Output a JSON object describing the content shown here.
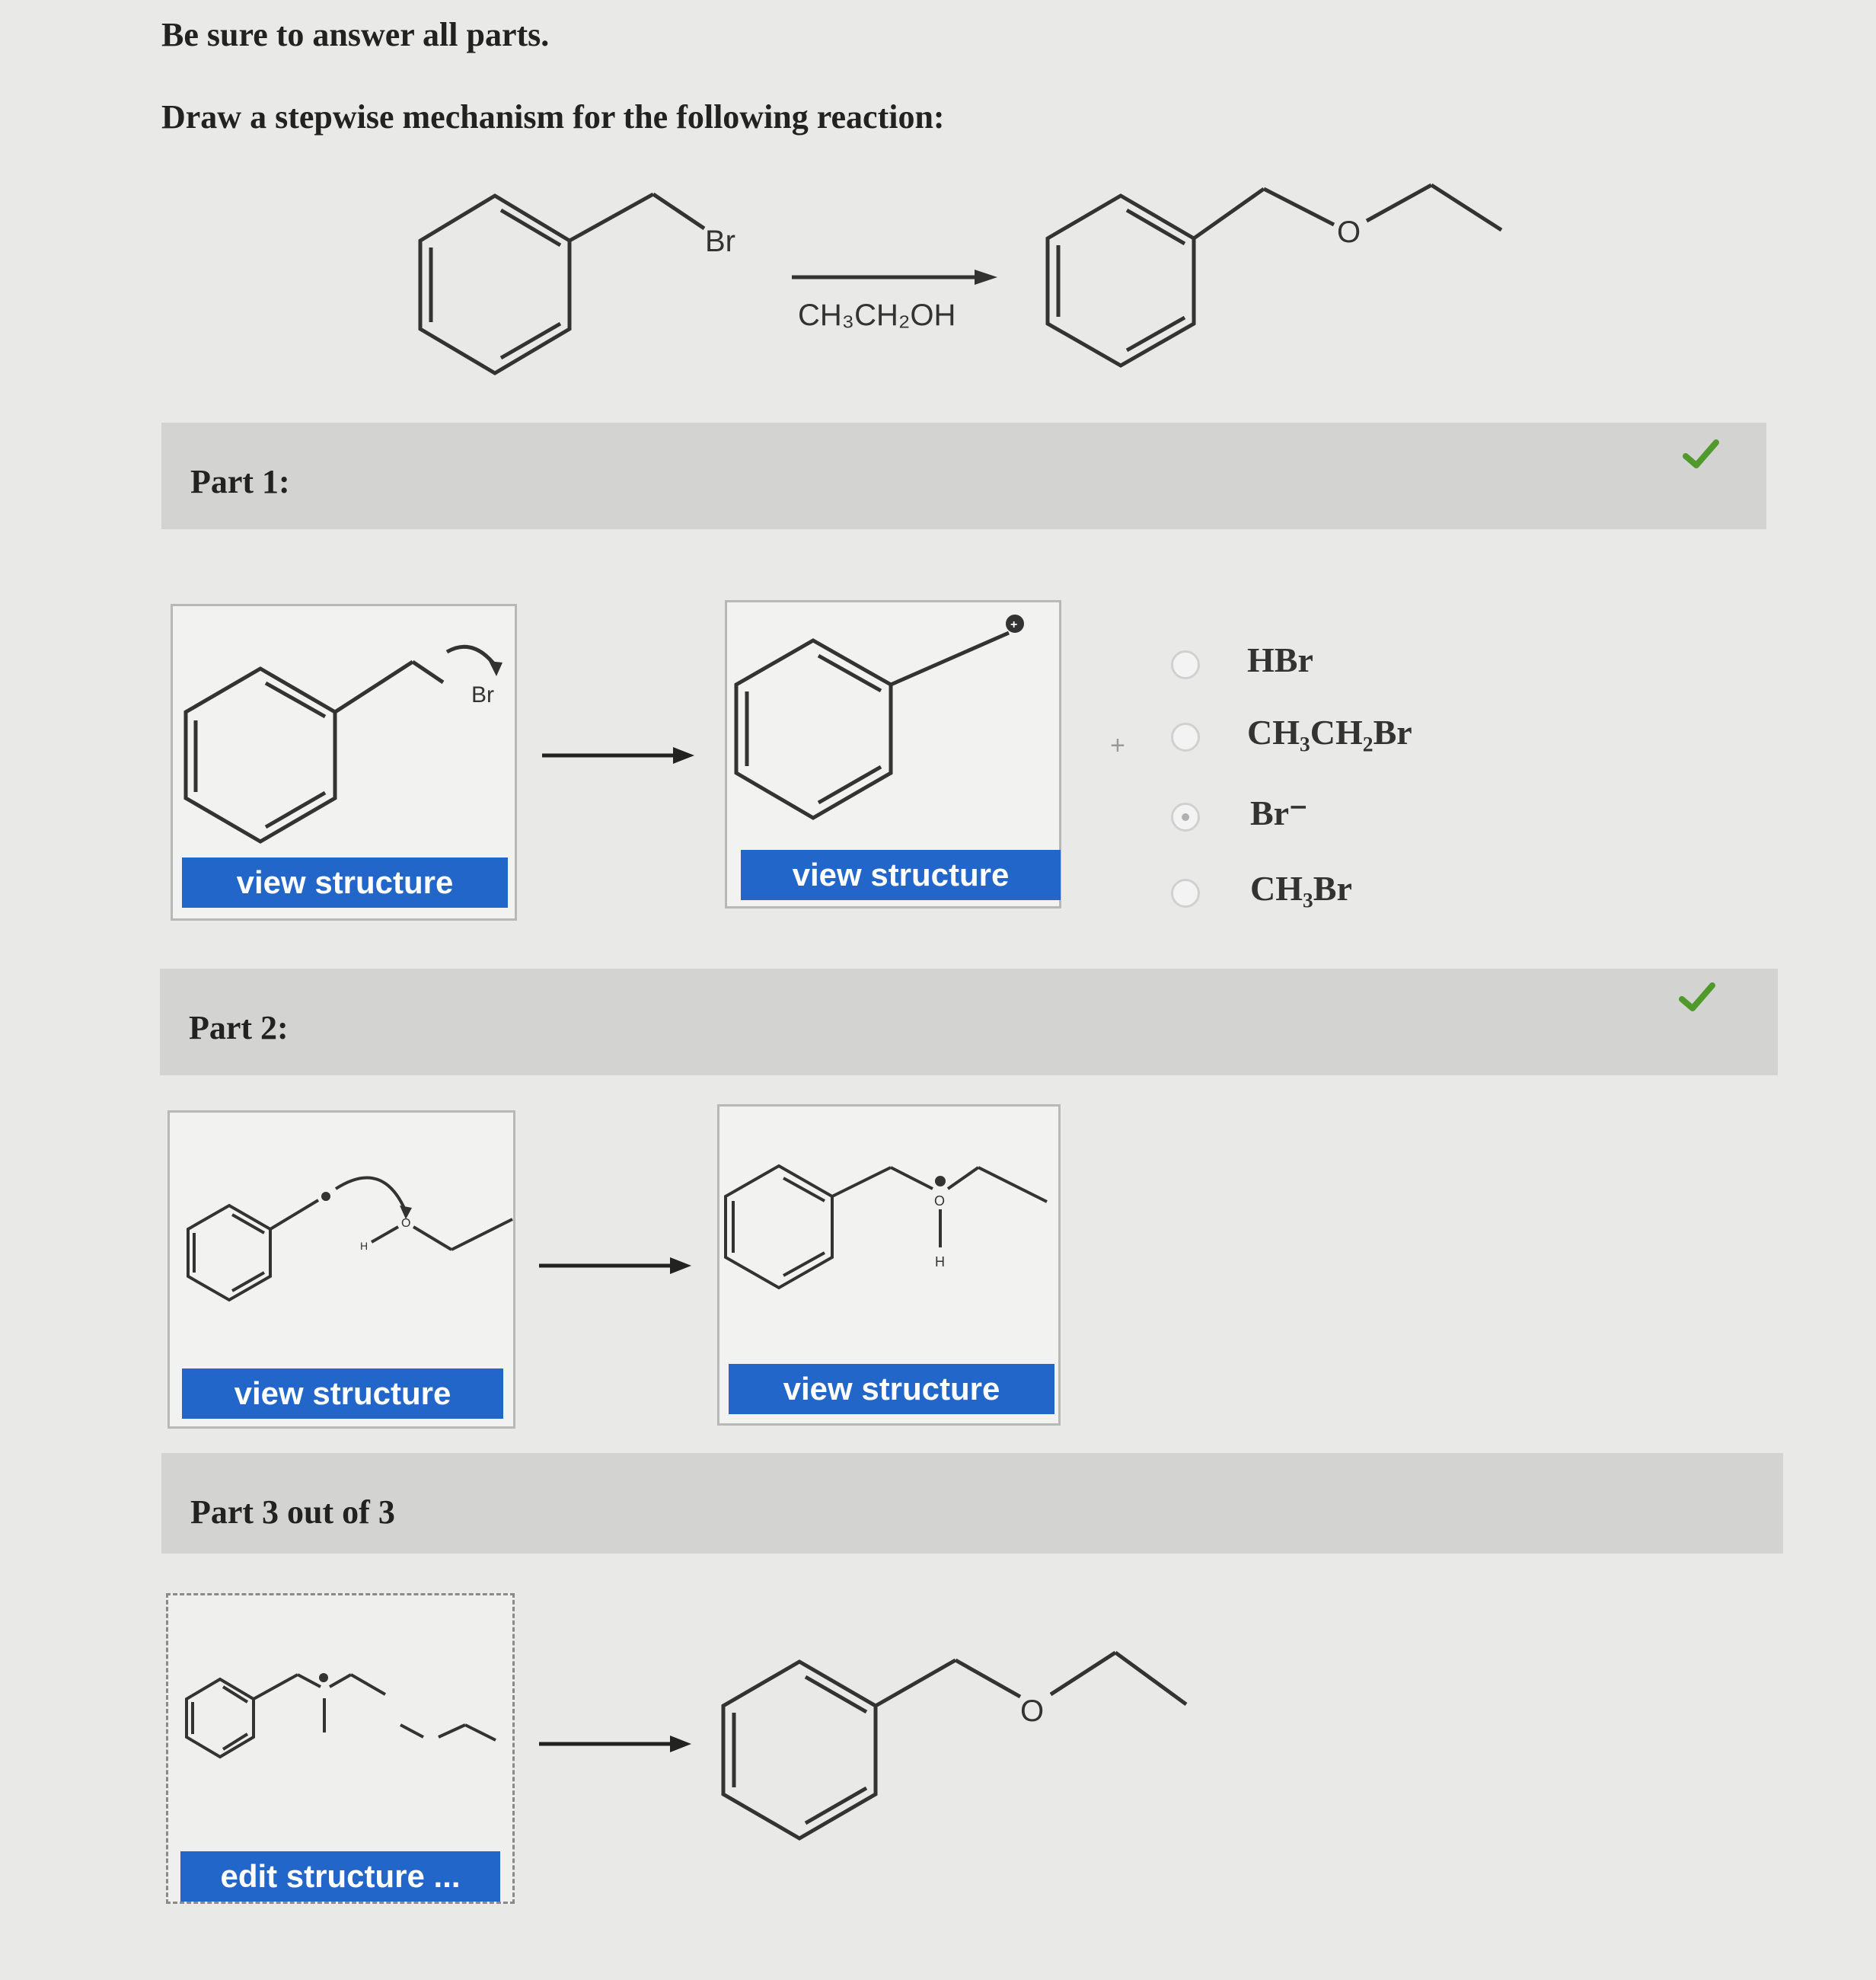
{
  "instructions": {
    "line1": "Be sure to answer all parts.",
    "line2": "Draw a stepwise mechanism for the following reaction:"
  },
  "reaction": {
    "reactant_atom": "Br",
    "reagent": "CH₃CH₂OH",
    "product_atom": "O"
  },
  "part1": {
    "label": "Part 1:",
    "status_icon": "check-icon",
    "left_button": "view structure",
    "right_button": "view structure",
    "left_atom": "Br",
    "plus_sign": "+",
    "options": [
      "HBr",
      "CH₃CH₂Br",
      "Br⁻",
      "CH₃Br"
    ],
    "selected_option": "Br⁻"
  },
  "part2": {
    "label": "Part 2:",
    "status_icon": "check-icon",
    "left_button": "view structure",
    "right_button": "view structure"
  },
  "part3": {
    "label": "Part 3 out of 3",
    "left_button": "edit structure ...",
    "product_atom": "O"
  },
  "colors": {
    "button_blue": "#2166c8",
    "check_green": "#4f9a2a",
    "part_bar": "#d3d3d2"
  }
}
